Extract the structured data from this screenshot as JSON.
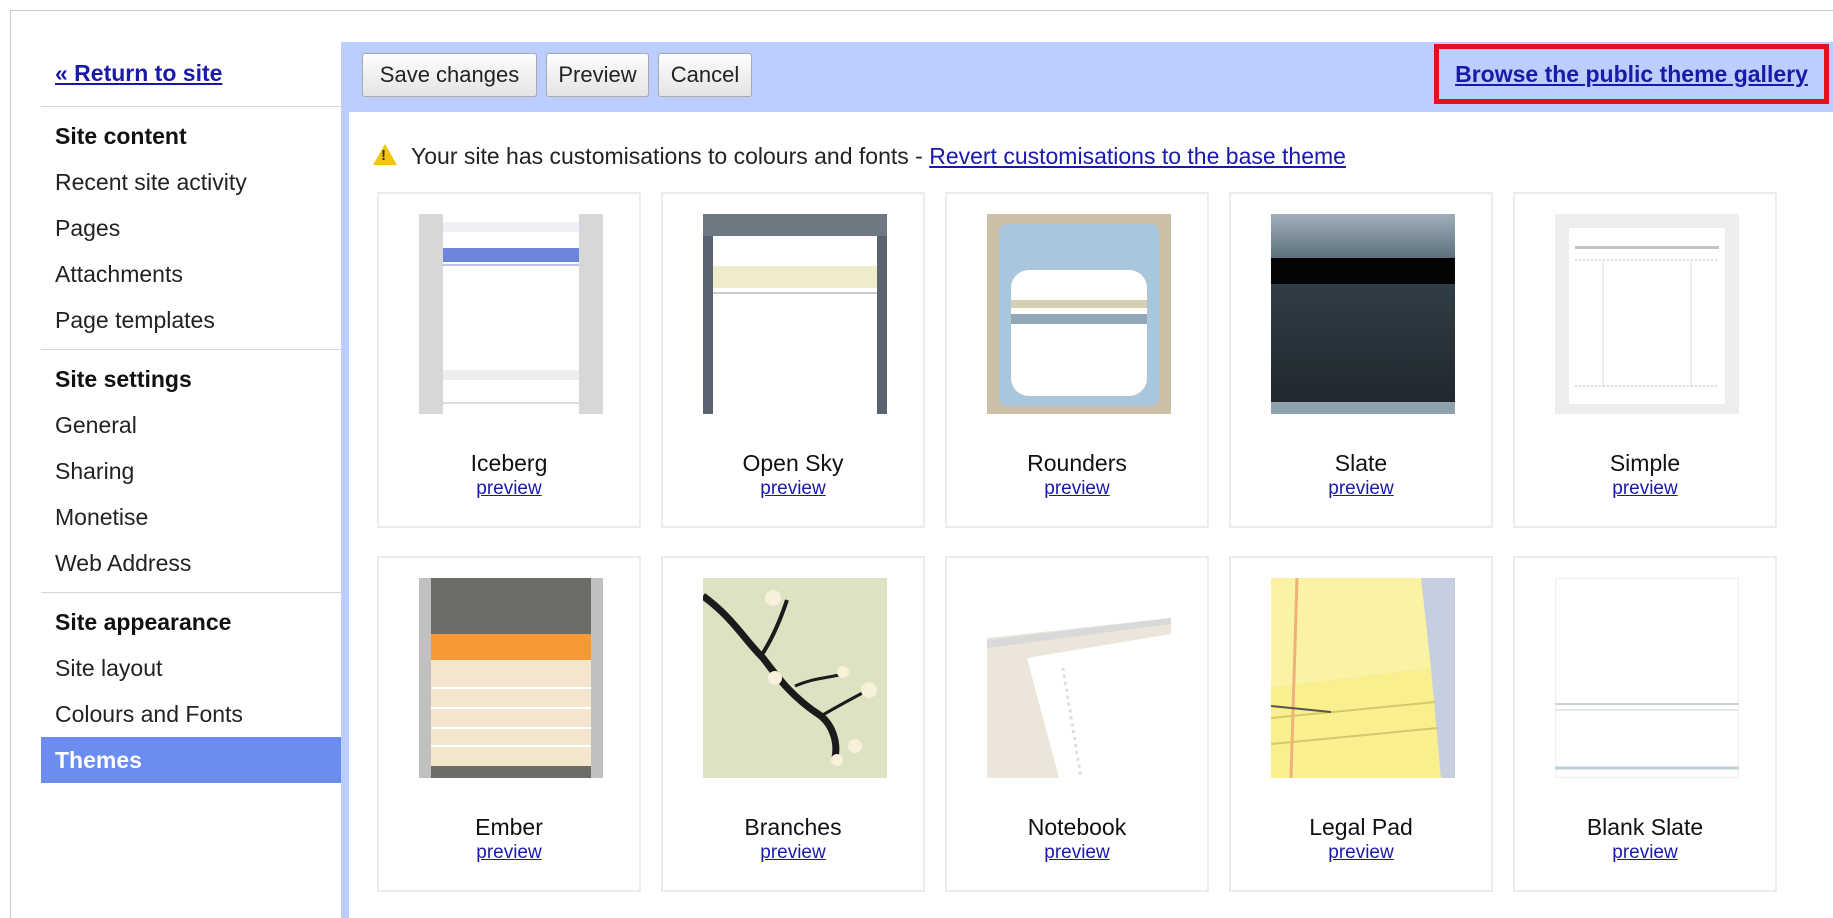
{
  "sidebar": {
    "return_label": "« Return to site",
    "sections": [
      {
        "title": "Site content",
        "items": [
          "Recent site activity",
          "Pages",
          "Attachments",
          "Page templates"
        ]
      },
      {
        "title": "Site settings",
        "items": [
          "General",
          "Sharing",
          "Monetise",
          "Web Address"
        ]
      },
      {
        "title": "Site appearance",
        "items": [
          "Site layout",
          "Colours and Fonts",
          "Themes"
        ]
      }
    ],
    "active_item": "Themes"
  },
  "toolbar": {
    "save_label": "Save changes",
    "preview_label": "Preview",
    "cancel_label": "Cancel",
    "gallery_label": "Browse the public theme gallery"
  },
  "notice": {
    "icon": "warning-icon",
    "text": "Your site has customisations to colours and fonts - ",
    "link": "Revert customisations to the base theme"
  },
  "themes": [
    {
      "name": "Iceberg",
      "preview": "preview"
    },
    {
      "name": "Open Sky",
      "preview": "preview"
    },
    {
      "name": "Rounders",
      "preview": "preview"
    },
    {
      "name": "Slate",
      "preview": "preview"
    },
    {
      "name": "Simple",
      "preview": "preview"
    },
    {
      "name": "Ember",
      "preview": "preview"
    },
    {
      "name": "Branches",
      "preview": "preview"
    },
    {
      "name": "Notebook",
      "preview": "preview"
    },
    {
      "name": "Legal Pad",
      "preview": "preview"
    },
    {
      "name": "Blank Slate",
      "preview": "preview"
    }
  ],
  "colors": {
    "toolbar_bg": "#bccdff",
    "active_nav": "#6b8def",
    "link": "#1a1aa8",
    "highlight_box": "#e2101c"
  }
}
